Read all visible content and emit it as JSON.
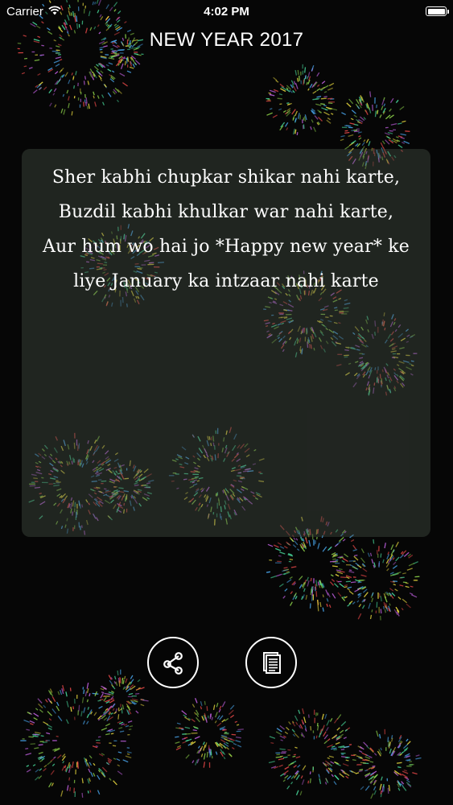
{
  "status_bar": {
    "carrier": "Carrier",
    "time": "4:02 PM",
    "wifi_icon": "wifi-icon",
    "battery_icon": "battery-icon"
  },
  "nav": {
    "title": "NEW YEAR 2017"
  },
  "quote": {
    "text": "Sher kabhi chupkar shikar nahi karte, Buzdil kabhi khulkar war nahi karte, Aur hum wo hai jo *Happy new year* ke liye January ka intzaar nahi karte"
  },
  "actions": {
    "share_icon": "share-icon",
    "copy_icon": "copy-icon"
  },
  "colors": {
    "background": "#060606",
    "text": "#ffffff",
    "card": "#46504680",
    "firework_palette": [
      "#8ed44a",
      "#f0e040",
      "#e84848",
      "#4aa8f0",
      "#4ae0a0",
      "#c060e0"
    ]
  }
}
